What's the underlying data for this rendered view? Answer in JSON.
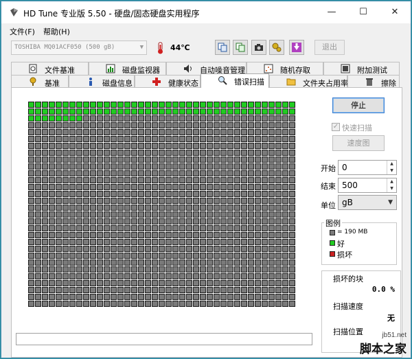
{
  "window": {
    "title": "HD Tune 专业版 5.50 - 硬盘/固态硬盘实用程序",
    "controls": {
      "minimize": "—",
      "maximize": "☐",
      "close": "✕"
    }
  },
  "menu": {
    "file": "文件(F)",
    "help": "帮助(H)"
  },
  "toolbar": {
    "drive": "TOSHIBA MQ01ACF050 (500 gB)",
    "temperature": "44℃",
    "exit_label": "退出",
    "icons": [
      "copy-info-icon",
      "copy-screenshot-icon",
      "camera-icon",
      "options-icon",
      "save-download-icon"
    ]
  },
  "tabs": {
    "row1": [
      {
        "label": "文件基准",
        "icon": "file-benchmark-icon"
      },
      {
        "label": "磁盘监视器",
        "icon": "disk-monitor-icon"
      },
      {
        "label": "自动噪音管理",
        "icon": "speaker-icon"
      },
      {
        "label": "随机存取",
        "icon": "random-access-icon"
      },
      {
        "label": "附加测试",
        "icon": "extra-tests-icon"
      }
    ],
    "row2": [
      {
        "label": "基准",
        "icon": "benchmark-icon"
      },
      {
        "label": "磁盘信息",
        "icon": "info-icon"
      },
      {
        "label": "健康状态",
        "icon": "health-icon"
      },
      {
        "label": "错误扫描",
        "icon": "magnifier-icon",
        "active": true
      },
      {
        "label": "文件夹占用率",
        "icon": "folder-icon"
      },
      {
        "label": "擦除",
        "icon": "trash-icon"
      }
    ]
  },
  "scan": {
    "grid_cols": 39,
    "grid_rows": 30,
    "scanned_blocks": 86,
    "colors": {
      "good": "#22cc22",
      "pending": "#7a7a7a",
      "bad": "#cc2222"
    }
  },
  "side": {
    "stop_label": "停止",
    "quick_scan_label": "快速扫描",
    "quick_scan_checked": true,
    "map_label": "速度图",
    "start_label": "开始",
    "start_value": "0",
    "end_label": "结束",
    "end_value": "500",
    "unit_label": "单位",
    "unit_value": "gB"
  },
  "legend": {
    "title": "图例",
    "block_size": "= 190 MB",
    "good": "好",
    "bad": "损坏"
  },
  "stats": {
    "damaged_label": "损坏的块",
    "damaged_value": "0.0 %",
    "speed_label": "扫描速度",
    "speed_value": "无",
    "position_label": "扫描位置"
  },
  "watermark": {
    "url": "jb51.net",
    "name": "脚本之家"
  }
}
